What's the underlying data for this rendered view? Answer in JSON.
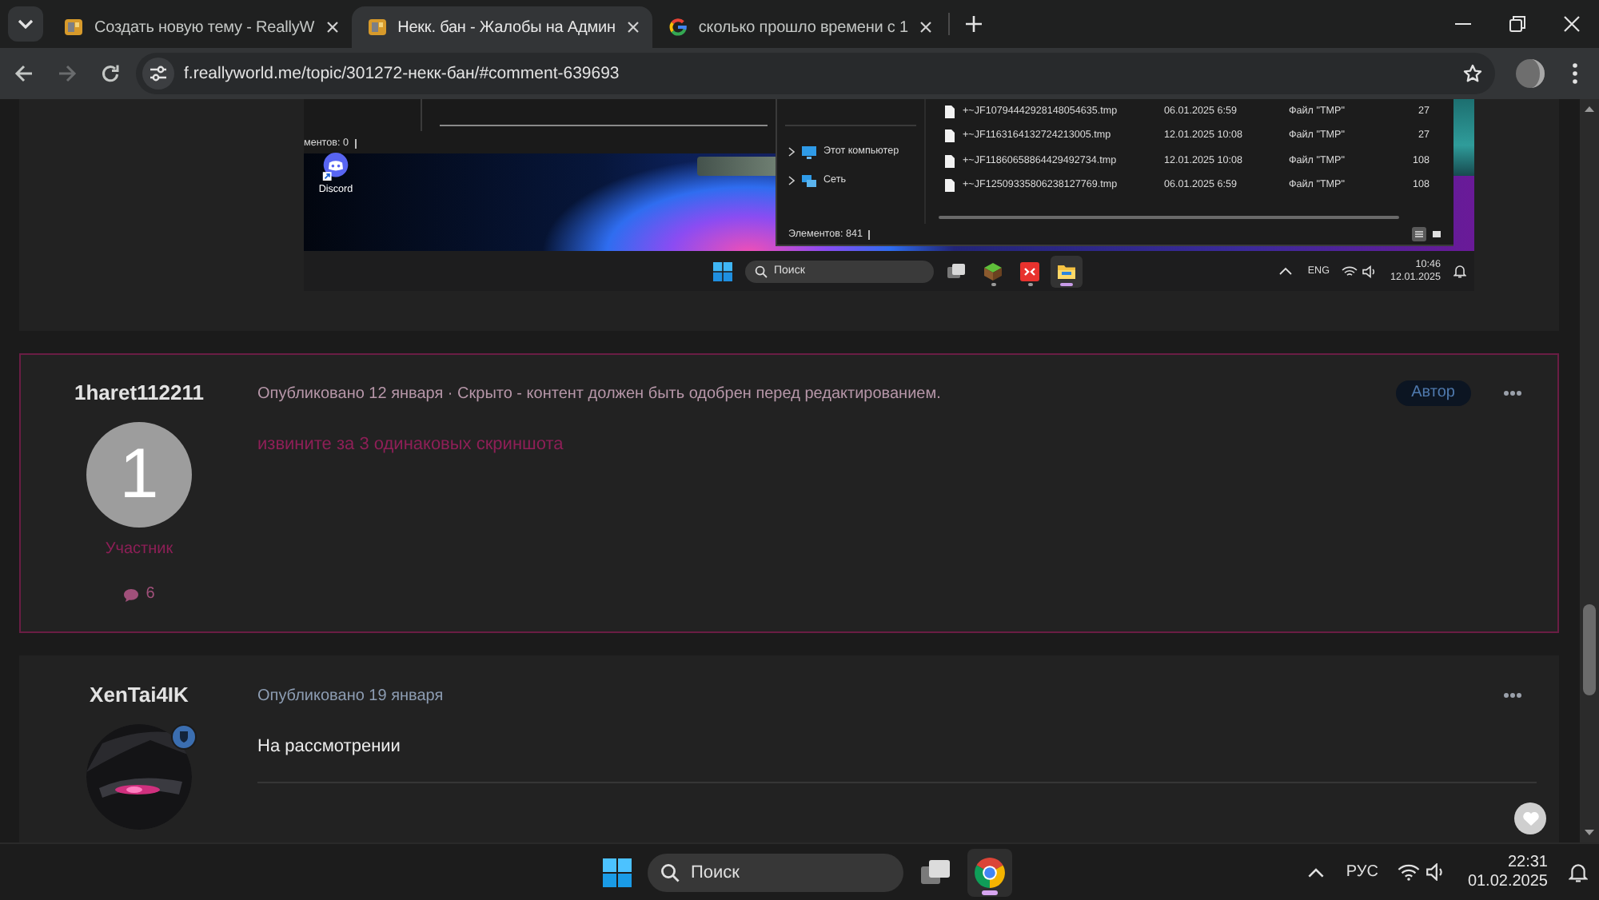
{
  "browser": {
    "tabs": [
      {
        "title": "Создать новую тему - ReallyW",
        "kind": "site",
        "selected": false
      },
      {
        "title": "Некк. бан - Жалобы на Админ",
        "kind": "site",
        "selected": true
      },
      {
        "title": "сколько прошло времени с 1",
        "kind": "search",
        "selected": false
      }
    ],
    "back_disabled": false,
    "forward_disabled": true,
    "url": "f.reallyworld.me/topic/301272-некк-бан/#comment-639693"
  },
  "previous_post": {
    "screenshot": {
      "back_window_status": "ментов: 0",
      "desktop_icons": [
        {
          "label": "Discord"
        }
      ],
      "explorer": {
        "nav": [
          {
            "label": "Этот компьютер",
            "kind": "pc"
          },
          {
            "label": "Сеть",
            "kind": "network"
          }
        ],
        "files": [
          {
            "name": "+~JF10794442928148054635.tmp",
            "date": "06.01.2025 6:59",
            "type": "Файл \"TMP\"",
            "size": "27"
          },
          {
            "name": "+~JF1163164132724213005.tmp",
            "date": "12.01.2025 10:08",
            "type": "Файл \"TMP\"",
            "size": "27"
          },
          {
            "name": "+~JF11860658864429492734.tmp",
            "date": "12.01.2025 10:08",
            "type": "Файл \"TMP\"",
            "size": "108"
          },
          {
            "name": "+~JF12509335806238127769.tmp",
            "date": "06.01.2025 6:59",
            "type": "Файл \"TMP\"",
            "size": "108"
          }
        ],
        "status": "Элементов: 841",
        "views": [
          {
            "kind": "details",
            "selected": true
          },
          {
            "kind": "tiles",
            "selected": false
          }
        ]
      },
      "taskbar": {
        "search_placeholder": "Поиск",
        "apps": [
          {
            "kind": "task-view",
            "running": false,
            "focused": false
          },
          {
            "kind": "cube",
            "running": true,
            "focused": false
          },
          {
            "kind": "remote",
            "running": true,
            "focused": false
          },
          {
            "kind": "folder",
            "running": true,
            "focused": true
          }
        ],
        "language": "ENG",
        "time": "10:46",
        "date": "12.01.2025"
      }
    }
  },
  "posts": [
    {
      "author": "1haret112211",
      "avatar": {
        "kind": "letter",
        "text": "1"
      },
      "staff_badge": false,
      "rank": "Участник",
      "post_count": "6",
      "meta": "Опубликовано 12 января · Скрыто - контент должен быть одобрен перед редактированием.",
      "author_tag": "Автор",
      "hidden": true,
      "body": "извините за 3 одинаковых скриншота",
      "can_react": false
    },
    {
      "author": "XenTai4IK",
      "avatar": {
        "kind": "image"
      },
      "staff_badge": true,
      "meta": "Опубликовано 19 января",
      "hidden": false,
      "body": "На рассмотрении",
      "can_react": true
    }
  ],
  "taskbar": {
    "search_placeholder": "Поиск",
    "apps": [
      {
        "kind": "task-view",
        "running": false,
        "focused": false
      },
      {
        "kind": "browser",
        "running": true,
        "focused": true
      }
    ],
    "language": "РУС",
    "time": "22:31",
    "date": "01.02.2025"
  }
}
